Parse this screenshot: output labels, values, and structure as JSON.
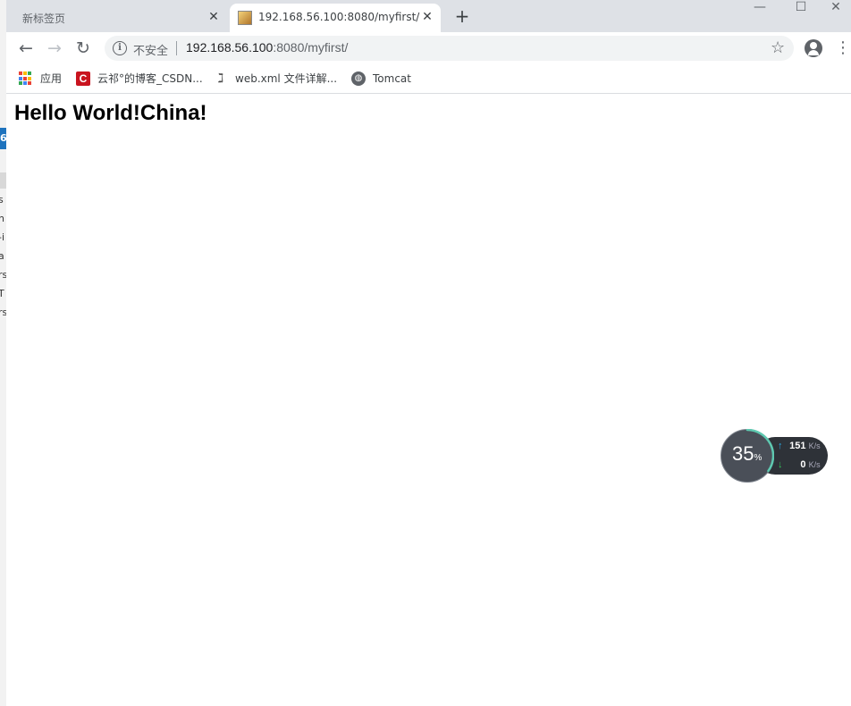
{
  "background_window": {
    "blue_label": "6",
    "fragments": [
      "s",
      "n",
      "-i",
      "a",
      "rs",
      "T",
      "rs"
    ]
  },
  "tabs": [
    {
      "title": "新标签页",
      "active": false
    },
    {
      "title": "192.168.56.100:8080/myfirst/",
      "active": true
    }
  ],
  "window_controls": {
    "minimize": "—",
    "maximize": "☐",
    "close": "✕"
  },
  "toolbar": {
    "back": "←",
    "forward": "→",
    "reload": "↻",
    "security_label": "不安全",
    "url_host": "192.168.56.100",
    "url_rest": ":8080/myfirst/",
    "bookmark_star": "☆",
    "menu": "⋮"
  },
  "bookmarks": [
    {
      "label": "应用",
      "icon": "apps-grid-icon"
    },
    {
      "label": "云祁°的博客_CSDN...",
      "icon": "csdn-icon"
    },
    {
      "label": "web.xml 文件详解...",
      "icon": "webxml-icon"
    },
    {
      "label": "Tomcat",
      "icon": "globe-icon"
    }
  ],
  "page": {
    "heading": "Hello World!China!"
  },
  "net_widget": {
    "percent": "35",
    "percent_sign": "%",
    "percent_value": 35,
    "upload": "151",
    "download": "0",
    "unit": "K/s",
    "up_arrow": "↑",
    "down_arrow": "↓"
  },
  "colors": {
    "tabbar_bg": "#dee1e6",
    "csdn_red": "#c9141f",
    "widget_bg": "#2e3238",
    "upload_blue": "#29a7e1",
    "download_green": "#34c35a",
    "gauge_teal": "#5ec8b0"
  }
}
